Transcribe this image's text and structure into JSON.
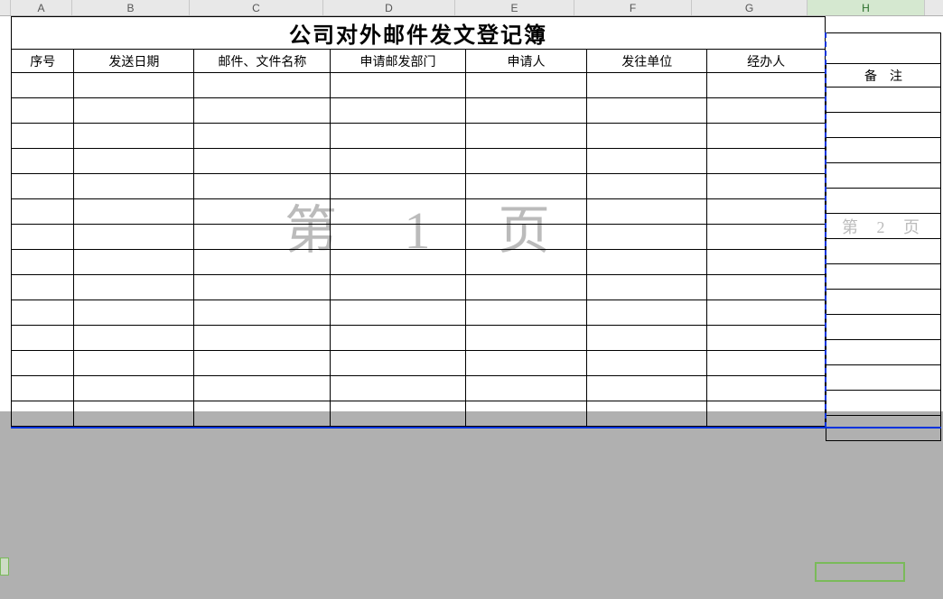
{
  "columns": {
    "labels": [
      "A",
      "B",
      "C",
      "D",
      "E",
      "F",
      "G",
      "H"
    ],
    "widths": [
      68,
      130,
      148,
      146,
      132,
      130,
      128,
      130
    ],
    "active_index": 7
  },
  "document": {
    "title": "公司对外邮件发文登记簿",
    "headers": [
      "序号",
      "发送日期",
      "邮件、文件名称",
      "申请邮发部门",
      "申请人",
      "发往单位",
      "经办人",
      "备　注"
    ],
    "data_row_count": 14
  },
  "watermarks": {
    "page1": "第 1 页",
    "page2": "第 2 页"
  }
}
